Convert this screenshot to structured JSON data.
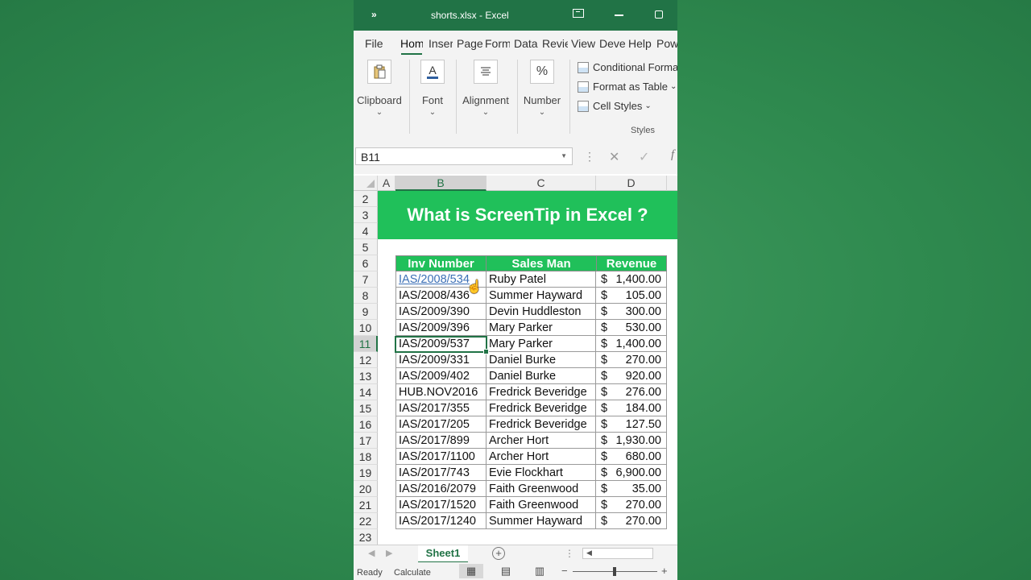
{
  "window": {
    "title": "shorts.xlsx  -  Excel",
    "more_icon": "»"
  },
  "tabs": [
    "File",
    "Hom",
    "Inser",
    "Page",
    "Form",
    "Data",
    "Revie",
    "View",
    "Deve",
    "Help",
    "Pow"
  ],
  "active_tab": "Hom",
  "ribbon": {
    "groups": [
      {
        "label": "Clipboard",
        "icon": "clipboard-icon"
      },
      {
        "label": "Font",
        "icon": "font-color-icon"
      },
      {
        "label": "Alignment",
        "icon": "align-icon"
      },
      {
        "label": "Number",
        "icon": "percent-icon"
      }
    ],
    "styles": {
      "conditional": "Conditional Formatting",
      "format_table": "Format as Table",
      "cell_styles": "Cell Styles",
      "group_label": "Styles"
    }
  },
  "formula_bar": {
    "name_box": "B11",
    "fx": "f"
  },
  "columns": [
    "A",
    "B",
    "C",
    "D"
  ],
  "selected_column": "B",
  "rows": [
    "2",
    "3",
    "4",
    "5",
    "6",
    "7",
    "8",
    "9",
    "10",
    "11",
    "12",
    "13",
    "14",
    "15",
    "16",
    "17",
    "18",
    "19",
    "20",
    "21",
    "22",
    "23"
  ],
  "selected_row": "11",
  "banner": "What is ScreenTip in Excel ?",
  "table": {
    "headers": [
      "Inv Number",
      "Sales Man",
      "Revenue"
    ],
    "currency": "$",
    "records": [
      {
        "inv": "IAS/2008/534",
        "sales": "Ruby Patel",
        "rev": "1,400.00"
      },
      {
        "inv": "IAS/2008/436",
        "sales": "Summer Hayward",
        "rev": "105.00"
      },
      {
        "inv": "IAS/2009/390",
        "sales": "Devin Huddleston",
        "rev": "300.00"
      },
      {
        "inv": "IAS/2009/396",
        "sales": "Mary Parker",
        "rev": "530.00"
      },
      {
        "inv": "IAS/2009/537",
        "sales": "Mary Parker",
        "rev": "1,400.00"
      },
      {
        "inv": "IAS/2009/331",
        "sales": "Daniel Burke",
        "rev": "270.00"
      },
      {
        "inv": "IAS/2009/402",
        "sales": "Daniel Burke",
        "rev": "920.00"
      },
      {
        "inv": "HUB.NOV2016",
        "sales": "Fredrick Beveridge",
        "rev": "276.00"
      },
      {
        "inv": "IAS/2017/355",
        "sales": "Fredrick Beveridge",
        "rev": "184.00"
      },
      {
        "inv": "IAS/2017/205",
        "sales": "Fredrick Beveridge",
        "rev": "127.50"
      },
      {
        "inv": "IAS/2017/899",
        "sales": "Archer Hort",
        "rev": "1,930.00"
      },
      {
        "inv": "IAS/2017/1100",
        "sales": "Archer Hort",
        "rev": "680.00"
      },
      {
        "inv": "IAS/2017/743",
        "sales": "Evie Flockhart",
        "rev": "6,900.00"
      },
      {
        "inv": "IAS/2016/2079",
        "sales": "Faith Greenwood",
        "rev": "35.00"
      },
      {
        "inv": "IAS/2017/1520",
        "sales": "Faith Greenwood",
        "rev": "270.00"
      },
      {
        "inv": "IAS/2017/1240",
        "sales": "Summer Hayward",
        "rev": "270.00"
      }
    ]
  },
  "sheet_tab": "Sheet1",
  "status": {
    "ready": "Ready",
    "calculate": "Calculate"
  },
  "colors": {
    "excel_green": "#217346",
    "banner_green": "#20c05a",
    "link_blue": "#3b6fb6"
  }
}
